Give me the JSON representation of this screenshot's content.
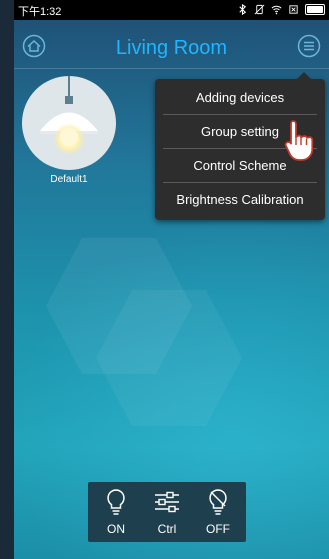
{
  "status_bar": {
    "time": "下午1:32"
  },
  "header": {
    "title": "Living Room"
  },
  "devices": [
    {
      "name": "Default1"
    }
  ],
  "menu": {
    "items": [
      {
        "label": "Adding devices"
      },
      {
        "label": "Group setting"
      },
      {
        "label": "Control Scheme"
      },
      {
        "label": "Brightness Calibration"
      }
    ]
  },
  "controls": {
    "on_label": "ON",
    "ctrl_label": "Ctrl",
    "off_label": "OFF"
  },
  "colors": {
    "title": "#21b5ff",
    "menu_bg": "#2d2d2d",
    "control_bar_bg": "#1e3f4e"
  }
}
